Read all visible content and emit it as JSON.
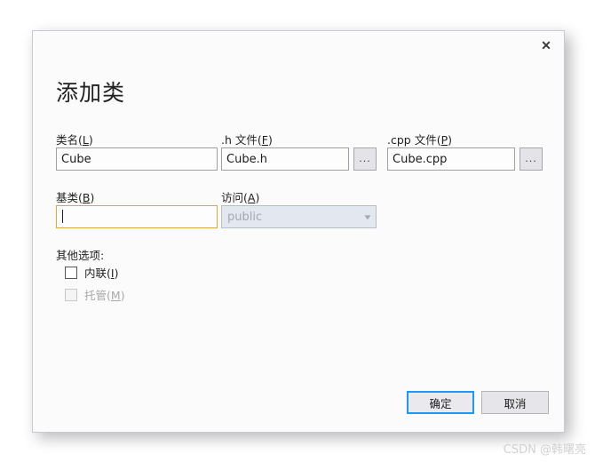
{
  "dialog": {
    "title": "添加类",
    "close_label": "✕"
  },
  "fields": {
    "class_name": {
      "label": "类名(",
      "mnemonic": "L",
      "label_end": ")",
      "value": "Cube",
      "placeholder": ""
    },
    "header_file": {
      "label": ".h 文件(",
      "mnemonic": "F",
      "label_end": ")",
      "value": "Cube.h",
      "placeholder": "",
      "browse_label": "..."
    },
    "cpp_file": {
      "label": ".cpp 文件(",
      "mnemonic": "P",
      "label_end": ")",
      "value": "Cube.cpp",
      "placeholder": "",
      "browse_label": "..."
    },
    "base_class": {
      "label": "基类(",
      "mnemonic": "B",
      "label_end": ")",
      "value": "",
      "placeholder": "",
      "focused": true
    },
    "access": {
      "label": "访问(",
      "mnemonic": "A",
      "label_end": ")",
      "value": "public",
      "disabled": true,
      "arrow": "▼"
    }
  },
  "other_options": {
    "group_label": "其他选项:",
    "items": [
      {
        "label": "内联(",
        "mnemonic": "I",
        "label_end": ")",
        "checked": false,
        "disabled": false
      },
      {
        "label": "托管(",
        "mnemonic": "M",
        "label_end": ")",
        "checked": false,
        "disabled": true
      }
    ]
  },
  "footer": {
    "ok_label": "确定",
    "cancel_label": "取消"
  },
  "watermark": {
    "text": "CSDN @韩曙亮"
  },
  "colors": {
    "focus_border": "#d9a93f",
    "default_button_border": "#2196f3",
    "dialog_border": "#c8c9d6",
    "dialog_background": "#fbfbfc"
  }
}
